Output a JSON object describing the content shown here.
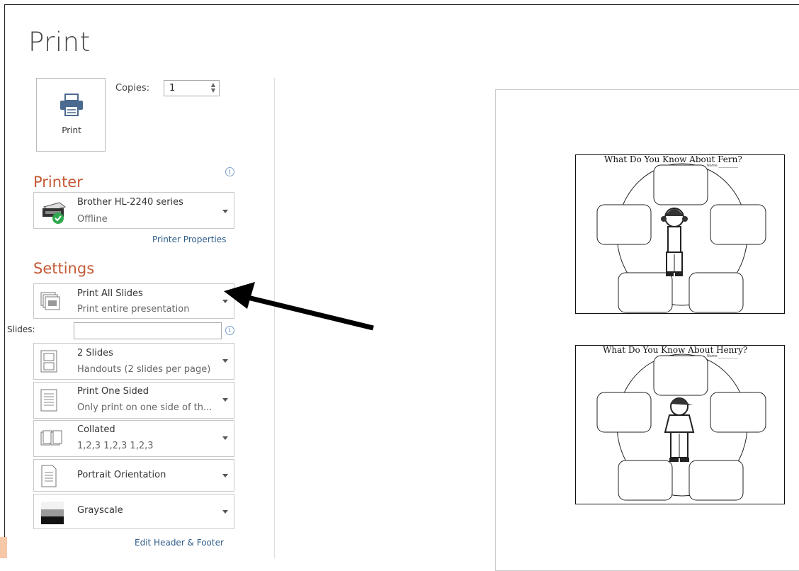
{
  "page": {
    "title": "Print"
  },
  "print_button": {
    "label": "Print",
    "icon": "printer-icon"
  },
  "copies": {
    "label": "Copies:",
    "value": "1"
  },
  "printer": {
    "section_title": "Printer",
    "name": "Brother HL-2240 series",
    "status": "Offline",
    "properties_link": "Printer Properties"
  },
  "settings": {
    "section_title": "Settings",
    "slides_label": "Slides:",
    "slides_value": "",
    "options": [
      {
        "line1": "Print All Slides",
        "line2": "Print entire presentation",
        "icon": "slides-stack-icon"
      },
      {
        "line1": "2 Slides",
        "line2": "Handouts (2 slides per page)",
        "icon": "two-slides-icon"
      },
      {
        "line1": "Print One Sided",
        "line2": "Only print on one side of th...",
        "icon": "one-sided-icon"
      },
      {
        "line1": "Collated",
        "line2": "1,2,3   1,2,3   1,2,3",
        "icon": "collated-icon"
      },
      {
        "line1": "Portrait Orientation",
        "line2": "",
        "icon": "portrait-icon"
      },
      {
        "line1": "Grayscale",
        "line2": "",
        "icon": "grayscale-icon"
      }
    ],
    "header_footer_link": "Edit Header & Footer"
  },
  "preview": {
    "slides": [
      {
        "title": "What Do You Know About Fern?",
        "name_label": "Name ___________"
      },
      {
        "title": "What Do You Know About Henry?",
        "name_label": "Name ___________"
      }
    ]
  },
  "colors": {
    "accent": "#c55a35",
    "link": "#2e5c8a"
  }
}
